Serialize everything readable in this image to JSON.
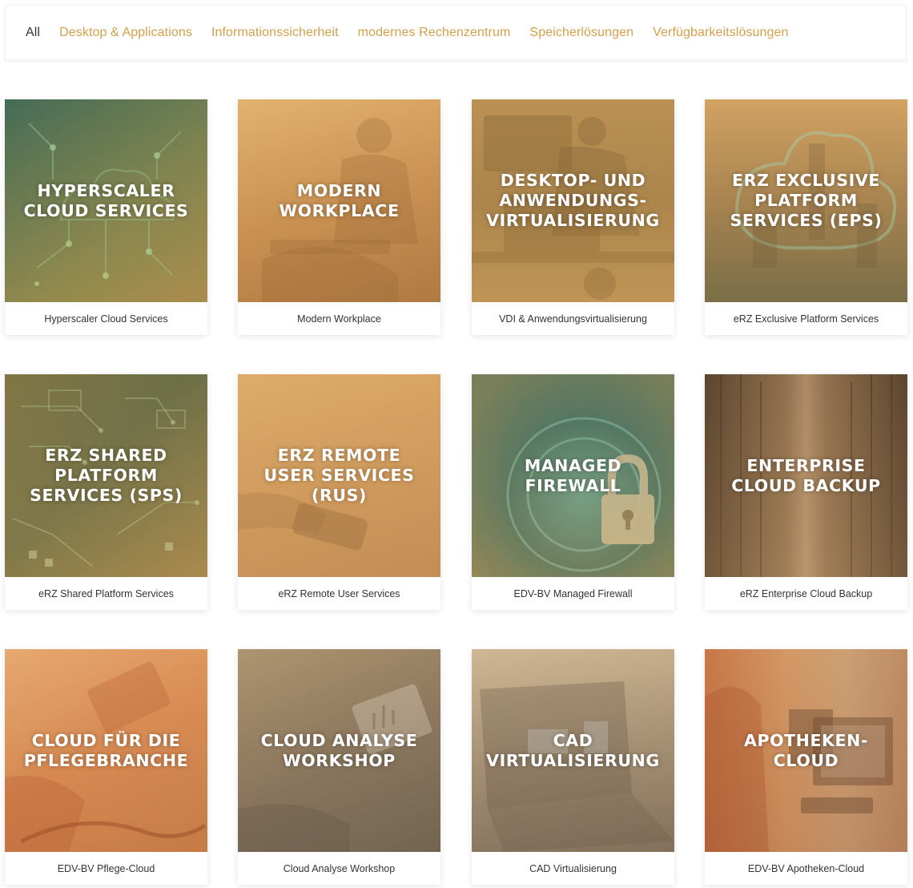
{
  "filters": [
    {
      "label": "All",
      "active": true
    },
    {
      "label": "Desktop & Applications",
      "active": false
    },
    {
      "label": "Informationssicherheit",
      "active": false
    },
    {
      "label": "modernes Rechenzentrum",
      "active": false
    },
    {
      "label": "Speicherlösungen",
      "active": false
    },
    {
      "label": "Verfügbarkeitslösungen",
      "active": false
    }
  ],
  "cards": [
    {
      "title": "HYPERSCALER\nCLOUD SERVICES",
      "caption": "Hyperscaler Cloud Services",
      "image": "cloud-network-icon",
      "colors": [
        "#4f6f55",
        "#9e8a4b"
      ]
    },
    {
      "title": "MODERN\nWORKPLACE",
      "caption": "Modern Workplace",
      "image": "person-laptop-icon",
      "colors": [
        "#d9a663",
        "#b98547"
      ]
    },
    {
      "title": "DESKTOP- UND\nANWENDUNGS-\nVIRTUALISIERUNG",
      "caption": "VDI & Anwendungsvirtualisierung",
      "image": "desk-monitor-icon",
      "colors": [
        "#a9834a",
        "#c99a55"
      ]
    },
    {
      "title": "ERZ EXCLUSIVE\nPLATFORM\nSERVICES (EPS)",
      "caption": "eRZ Exclusive Platform Services",
      "image": "city-cloud-icon",
      "colors": [
        "#c99758",
        "#8f7445"
      ]
    },
    {
      "title": "ERZ SHARED\nPLATFORM\nSERVICES (SPS)",
      "caption": "eRZ Shared Platform Services",
      "image": "circuit-board-icon",
      "colors": [
        "#6d6e45",
        "#a98b4d"
      ]
    },
    {
      "title": "ERZ REMOTE\nUSER SERVICES\n(RUS)",
      "caption": "eRZ Remote User Services",
      "image": "smartphone-hand-icon",
      "colors": [
        "#d6a462",
        "#c8935a"
      ]
    },
    {
      "title": "MANAGED\nFIREWALL",
      "caption": "EDV-BV Managed Firewall",
      "image": "padlock-icon",
      "colors": [
        "#4a7363",
        "#a58f55"
      ]
    },
    {
      "title": "ENTERPRISE\nCLOUD BACKUP",
      "caption": "eRZ Enterprise Cloud Backup",
      "image": "server-corridor-icon",
      "colors": [
        "#7a5a3c",
        "#a88458"
      ]
    },
    {
      "title": "CLOUD FÜR DIE\nPFLEGEBRANCHE",
      "caption": "EDV-BV Pflege-Cloud",
      "image": "tablet-stethoscope-icon",
      "colors": [
        "#e09b5f",
        "#c97a45"
      ]
    },
    {
      "title": "CLOUD ANALYSE\nWORKSHOP",
      "caption": "Cloud Analyse Workshop",
      "image": "tablet-chart-icon",
      "colors": [
        "#a38a66",
        "#7a6a54"
      ]
    },
    {
      "title": "CAD\nVIRTUALISIERUNG",
      "caption": "CAD Virtualisierung",
      "image": "laptop-cad-icon",
      "colors": [
        "#bea27d",
        "#8b775f"
      ]
    },
    {
      "title": "APOTHEKEN-CLOUD",
      "caption": "EDV-BV Apotheken-Cloud",
      "image": "pharmacy-computer-icon",
      "colors": [
        "#d19460",
        "#b06d45"
      ]
    }
  ]
}
